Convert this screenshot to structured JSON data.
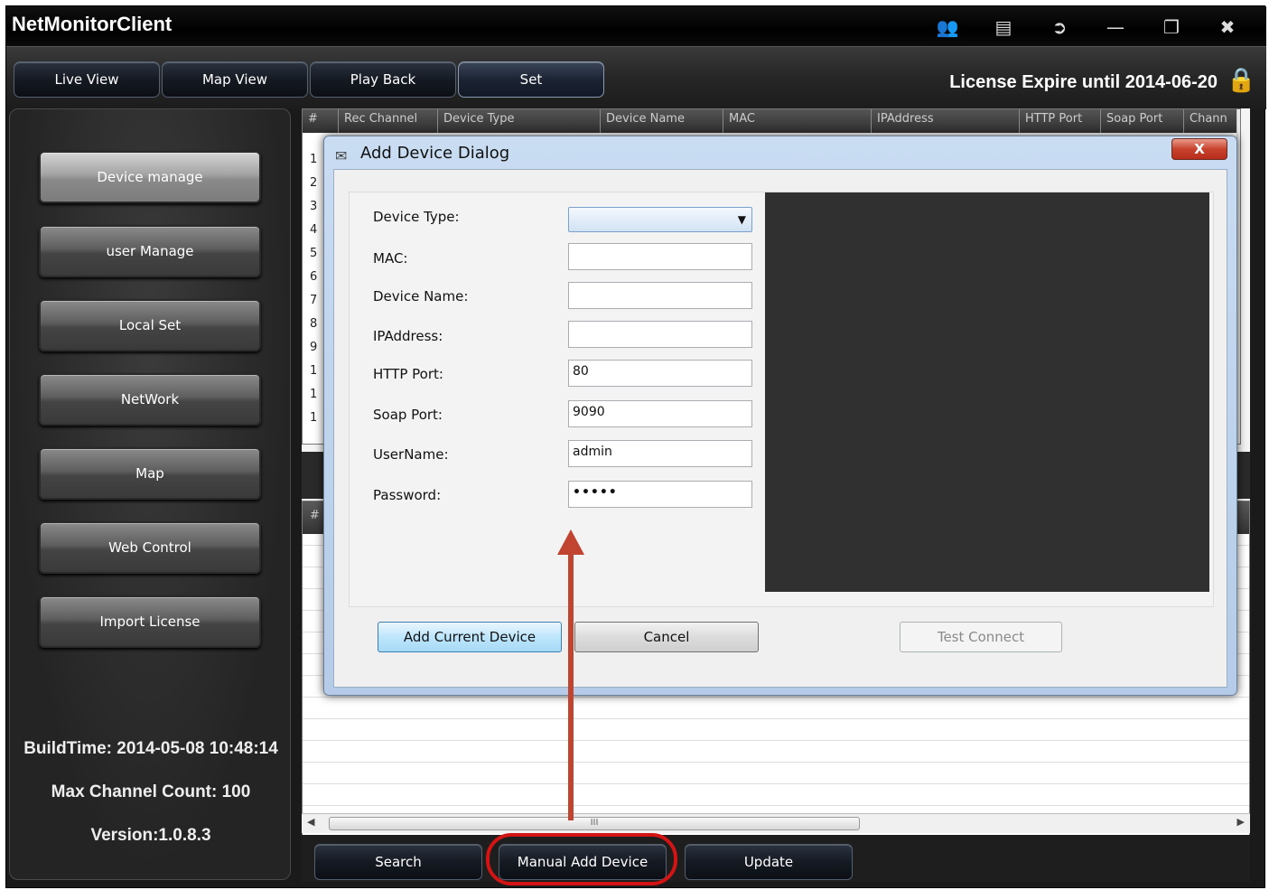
{
  "app": {
    "title": "NetMonitorClient",
    "license": "License Expire until 2014-06-20",
    "title_icons": [
      "users-icon",
      "layout-icon",
      "exit-icon",
      "minimize-icon",
      "restore-icon",
      "close-icon"
    ]
  },
  "nav": {
    "tabs": [
      {
        "label": "Live View"
      },
      {
        "label": "Map View"
      },
      {
        "label": "Play Back"
      },
      {
        "label": "Set",
        "active": true
      }
    ]
  },
  "sidebar": {
    "items": [
      {
        "label": "Device manage",
        "selected": true
      },
      {
        "label": "user Manage"
      },
      {
        "label": "Local Set"
      },
      {
        "label": "NetWork"
      },
      {
        "label": "Map"
      },
      {
        "label": "Web Control"
      },
      {
        "label": "Import License"
      }
    ],
    "build_time": "BuildTime: 2014-05-08 10:48:14",
    "max_channel": "Max Channel Count: 100",
    "version": "Version:1.0.8.3"
  },
  "table": {
    "columns": [
      "#",
      "Rec Channel",
      "Device Type",
      "Device Name",
      "MAC",
      "IPAddress",
      "HTTP Port",
      "Soap Port",
      "Chann"
    ],
    "rows": [
      "1",
      "2",
      "3",
      "4",
      "5",
      "6",
      "7",
      "8",
      "9",
      "1",
      "1",
      "1"
    ]
  },
  "lower_table": {
    "header_first": "#"
  },
  "scroll": {
    "thumb_label": "III"
  },
  "bottom": {
    "search": "Search",
    "manual_add": "Manual Add Device",
    "update": "Update"
  },
  "dialog": {
    "title": "Add Device Dialog",
    "close_label": "X",
    "fields": {
      "device_type": {
        "label": "Device Type:",
        "value": ""
      },
      "mac": {
        "label": "MAC:",
        "value": ""
      },
      "device_name": {
        "label": "Device Name:",
        "value": ""
      },
      "ip": {
        "label": "IPAddress:",
        "value": ""
      },
      "http_port": {
        "label": "HTTP Port:",
        "value": "80"
      },
      "soap_port": {
        "label": "Soap Port:",
        "value": "9090"
      },
      "username": {
        "label": "UserName:",
        "value": "admin"
      },
      "password": {
        "label": "Password:",
        "value": "•••••"
      }
    },
    "buttons": {
      "add": "Add Current Device",
      "cancel": "Cancel",
      "test": "Test Connect"
    }
  },
  "colors": {
    "annotation_red": "#d41414",
    "arrow": "#c0442f"
  }
}
